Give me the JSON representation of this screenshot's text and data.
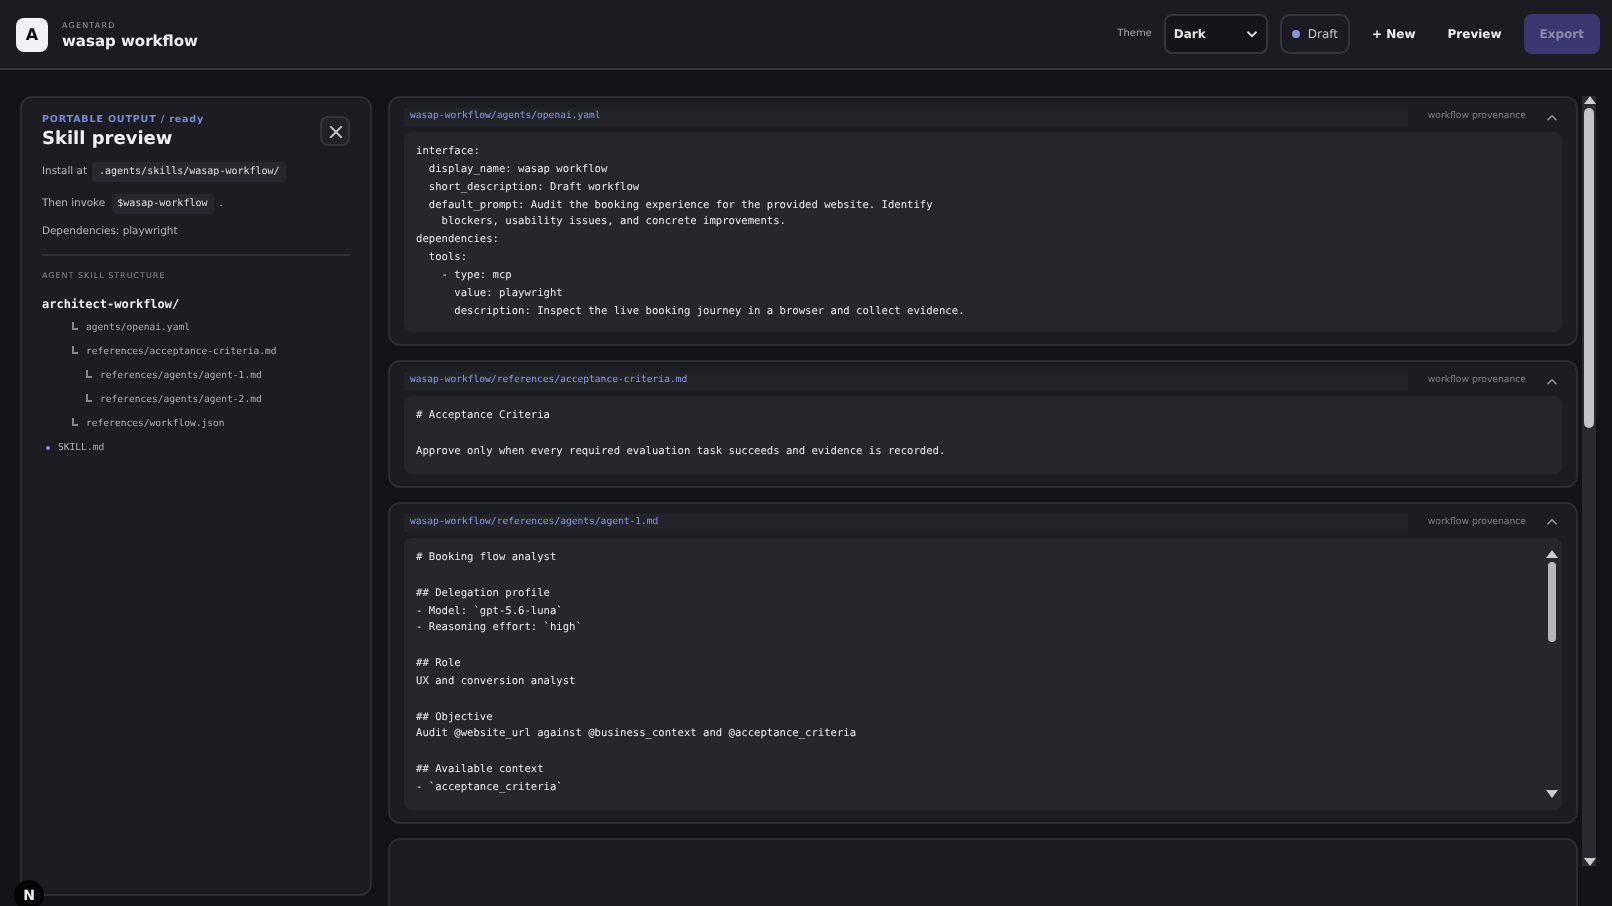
{
  "header": {
    "logo": "A",
    "app_name": "AGENTARD",
    "project": "wasap workflow",
    "theme_label": "Theme",
    "theme": "Dark",
    "status": "Draft",
    "new_button": "+ New",
    "preview_button": "Preview",
    "export_button": {
      "label": "Export",
      "disabled": true
    }
  },
  "panel": {
    "eyebrow": "PORTABLE OUTPUT / ready",
    "title": "Skill preview",
    "install": {
      "label": "Install at",
      "path": ".agents/skills/wasap-workflow/"
    },
    "invoke": {
      "label": "Then invoke",
      "command": "$wasap-workflow",
      "end": "."
    },
    "dependencies": "Dependencies: playwright",
    "structure_heading": "AGENT SKILL STRUCTURE",
    "tree": [
      {
        "label": "architect-workflow/",
        "kind": "root",
        "children": [
          {
            "label": "agents/openai.yaml",
            "kind": "branch"
          },
          {
            "label": "references/acceptance-criteria.md",
            "kind": "branch",
            "children": [
              {
                "label": "references/agents/agent-1.md",
                "kind": "branch"
              },
              {
                "label": "references/agents/agent-2.md",
                "kind": "branch"
              }
            ]
          },
          {
            "label": "references/workflow.json",
            "kind": "branch"
          }
        ]
      },
      {
        "label": "SKILL.md",
        "kind": "bullet"
      }
    ]
  },
  "files": [
    {
      "path": "wasap-workflow/agents/openai.yaml",
      "tag": "workflow provenance",
      "expanded": true,
      "scrollable": false,
      "content": "interface:\n  display_name: wasap workflow\n  short_description: Draft workflow\n  default_prompt: Audit the booking experience for the provided website. Identify\n    blockers, usability issues, and concrete improvements.\ndependencies:\n  tools:\n    - type: mcp\n      value: playwright\n      description: Inspect the live booking journey in a browser and collect evidence."
    },
    {
      "path": "wasap-workflow/references/acceptance-criteria.md",
      "tag": "workflow provenance",
      "expanded": true,
      "scrollable": false,
      "content": "# Acceptance Criteria\n\nApprove only when every required evaluation task succeeds and evidence is recorded."
    },
    {
      "path": "wasap-workflow/references/agents/agent-1.md",
      "tag": "workflow provenance",
      "expanded": true,
      "scrollable": true,
      "content": "# Booking flow analyst\n\n## Delegation profile\n- Model: `gpt-5.6-luna`\n- Reasoning effort: `high`\n\n## Role\nUX and conversion analyst\n\n## Objective\nAudit @website_url against @business_context and @acceptance_criteria\n\n## Available context\n- `acceptance_criteria`"
    }
  ],
  "dev_badge": "N"
}
